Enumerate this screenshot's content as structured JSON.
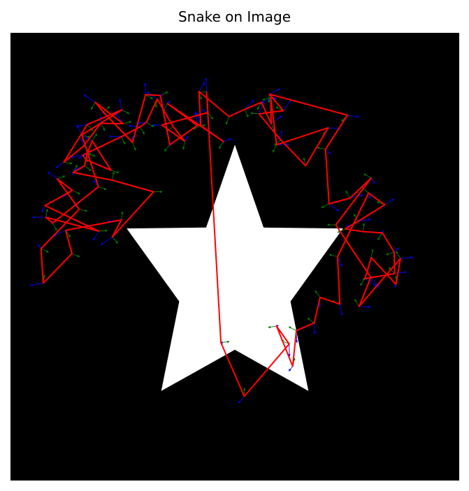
{
  "chart_data": {
    "type": "scatter",
    "title": "Snake on Image",
    "image": {
      "background": "#000000",
      "shape": "five-pointed star",
      "shape_color": "#ffffff"
    },
    "axes_visible": false,
    "grid": false,
    "legend": "none",
    "colors": {
      "snake": "#ff0000",
      "normal_arrows": "#008000",
      "force_arrows": "#0000ff"
    },
    "series": [
      {
        "name": "",
        "closed": true,
        "x": [
          0.437,
          0.44,
          0.337,
          0.388,
          0.363,
          0.327,
          0.303,
          0.289,
          0.247,
          0.161,
          0.169,
          0.224,
          0.182,
          0.171,
          0.165,
          0.14,
          0.226,
          0.319,
          0.227,
          0.247,
          0.123,
          0.137,
          0.073,
          0.068,
          0.153,
          0.104,
          0.138,
          0.077,
          0.197,
          0.079,
          0.094,
          0.196,
          0.159,
          0.248,
          0.171,
          0.119,
          0.163,
          0.201,
          0.251,
          0.189,
          0.207,
          0.272,
          0.301,
          0.334,
          0.355,
          0.416,
          0.35,
          0.475,
          0.424,
          0.42,
          0.487,
          0.522,
          0.559,
          0.581,
          0.58,
          0.593,
          0.708,
          0.658,
          0.602,
          0.554,
          0.608,
          0.577,
          0.751,
          0.702,
          0.71,
          0.757,
          0.804,
          0.725,
          0.803,
          0.777,
          0.869,
          0.859,
          0.804,
          0.79,
          0.856,
          0.855,
          0.829,
          0.786,
          0.746,
          0.775,
          0.834,
          0.798,
          0.729,
          0.734,
          0.69,
          0.677,
          0.637,
          0.629,
          0.593,
          0.621,
          0.521,
          0.469
        ],
        "y": [
          0.868,
          0.822,
          0.794,
          0.758,
          0.79,
          0.852,
          0.8,
          0.79,
          0.768,
          0.727,
          0.716,
          0.693,
          0.759,
          0.73,
          0.703,
          0.688,
          0.671,
          0.645,
          0.544,
          0.582,
          0.559,
          0.507,
          0.441,
          0.518,
          0.606,
          0.674,
          0.648,
          0.614,
          0.557,
          0.588,
          0.575,
          0.656,
          0.772,
          0.828,
          0.795,
          0.711,
          0.747,
          0.798,
          0.797,
          0.845,
          0.823,
          0.755,
          0.862,
          0.86,
          0.75,
          0.793,
          0.842,
          0.757,
          0.793,
          0.869,
          0.813,
          0.829,
          0.845,
          0.797,
          0.855,
          0.75,
          0.788,
          0.703,
          0.761,
          0.819,
          0.826,
          0.863,
          0.816,
          0.74,
          0.618,
          0.631,
          0.676,
          0.571,
          0.454,
          0.389,
          0.496,
          0.438,
          0.498,
          0.451,
          0.462,
          0.51,
          0.553,
          0.556,
          0.562,
          0.579,
          0.616,
          0.642,
          0.5,
          0.394,
          0.409,
          0.352,
          0.335,
          0.255,
          0.345,
          0.305,
          0.188,
          0.308
        ]
      }
    ],
    "star": {
      "x": [
        0.5,
        0.564,
        0.741,
        0.624,
        0.664,
        0.5,
        0.336,
        0.376,
        0.259,
        0.436
      ],
      "y": [
        0.75,
        0.565,
        0.563,
        0.4,
        0.2,
        0.292,
        0.2,
        0.4,
        0.563,
        0.565
      ]
    }
  }
}
